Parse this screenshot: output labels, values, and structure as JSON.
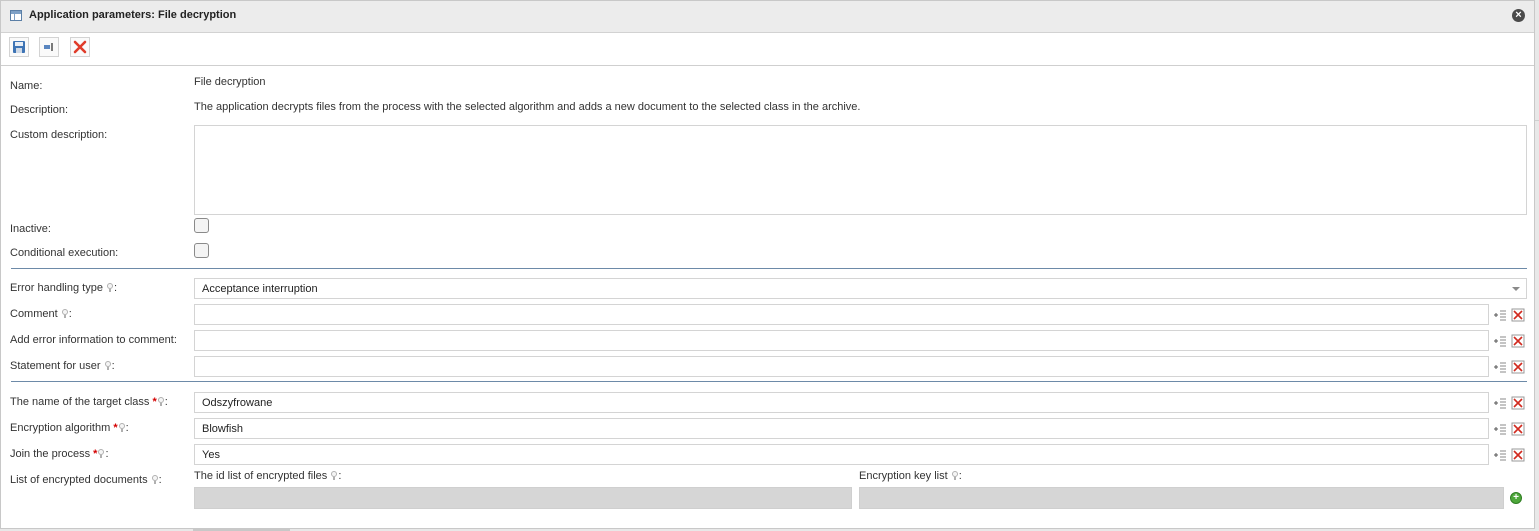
{
  "window": {
    "title": "Application parameters: File decryption"
  },
  "toolbar": {
    "save_icon": "save-icon",
    "exit_icon": "exit-icon",
    "delete_icon": "delete-icon"
  },
  "form": {
    "name_label": "Name:",
    "name_value": "File decryption",
    "description_label": "Description:",
    "description_value": "The application decrypts files from the process with the selected algorithm and adds a new document to the selected class in the archive.",
    "custom_description_label": "Custom description:",
    "custom_description_value": "",
    "inactive_label": "Inactive:",
    "inactive_checked": false,
    "conditional_label": "Conditional execution:",
    "conditional_checked": false,
    "error_handling_label": "Error handling type",
    "error_handling_value": "Acceptance interruption",
    "comment_label": "Comment",
    "comment_value": "",
    "add_error_label": "Add error information to comment:",
    "add_error_value": "",
    "statement_label": "Statement for user",
    "statement_value": "",
    "target_class_label": "The name of the target class",
    "target_class_value": "Odszyfrowane",
    "algorithm_label": "Encryption algorithm",
    "algorithm_value": "Blowfish",
    "join_label": "Join the process",
    "join_value": "Yes",
    "encrypted_docs_label": "List of encrypted documents",
    "id_list_label": "The id list of encrypted files",
    "key_list_label": "Encryption key list",
    "colon": ":",
    "required_mark": "*"
  },
  "colors": {
    "separator": "#6d8aa8",
    "required": "#d40000",
    "add_button": "#4ea83b"
  }
}
